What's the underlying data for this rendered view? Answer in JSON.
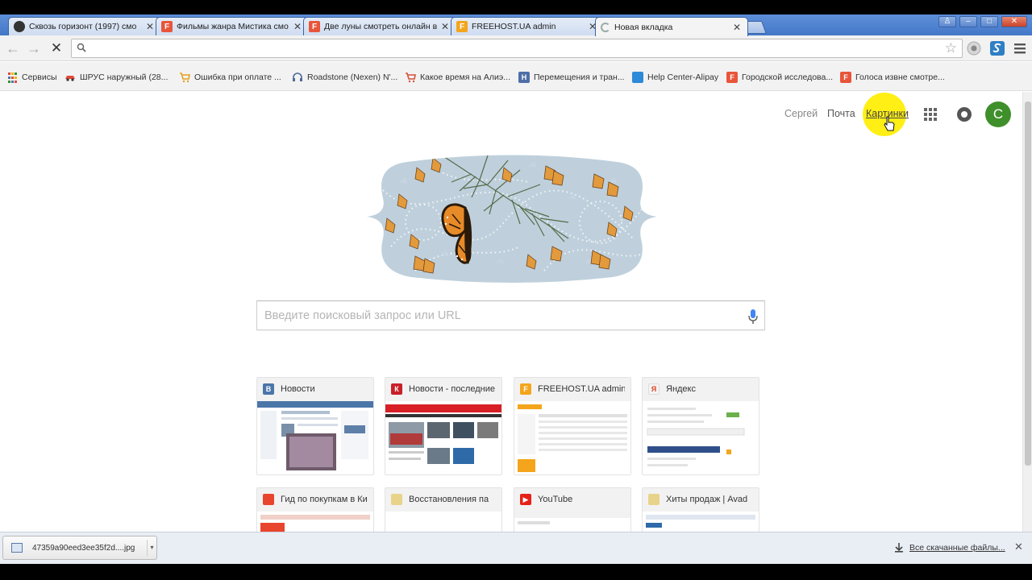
{
  "tabs": [
    {
      "title": "Сквозь горизонт (1997) смо",
      "icon": "mask-favicon-icon",
      "color": "#333333"
    },
    {
      "title": "Фильмы жанра Мистика смо",
      "icon": "f-favicon-icon",
      "color": "#e8553b"
    },
    {
      "title": "Две луны смотреть онлайн в",
      "icon": "f-favicon-icon",
      "color": "#e8553b"
    },
    {
      "title": "FREEHOST.UA admin",
      "icon": "freehost-favicon-icon",
      "color": "#f4a51c"
    },
    {
      "title": "Новая вкладка",
      "icon": "loading-spinner-icon",
      "color": "#999999",
      "active": true
    }
  ],
  "toolbar": {
    "search_glyph": "🔍"
  },
  "bookmarks": [
    {
      "label": "Сервисы",
      "color": "#d8473a",
      "glyph": ""
    },
    {
      "label": "ШРУС наружный (28...",
      "color": "#e04a3a",
      "glyph": ""
    },
    {
      "label": "Ошибка при оплате ...",
      "color": "#e6a021",
      "glyph": ""
    },
    {
      "label": "Roadstone (Nexen) N'...",
      "color": "#4d6a9a",
      "glyph": ""
    },
    {
      "label": "Какое время на Алиэ...",
      "color": "#d5523b",
      "glyph": ""
    },
    {
      "label": "Перемещения и тран...",
      "color": "#4e6ea6",
      "glyph": "H"
    },
    {
      "label": "Help Center-Alipay",
      "color": "#2c8ad8",
      "glyph": ""
    },
    {
      "label": "Городской исследова...",
      "color": "#e8553b",
      "glyph": "F"
    },
    {
      "label": "Голоса извне смотре...",
      "color": "#e8553b",
      "glyph": "F"
    }
  ],
  "header": {
    "user": "Сергей",
    "mail": "Почта",
    "images": "Картинки",
    "avatar_letter": "С"
  },
  "search": {
    "placeholder": "Введите поисковый запрос или URL"
  },
  "tiles": [
    {
      "title": "Новости",
      "color": "#4a76a8",
      "glyph": "В"
    },
    {
      "title": "Новости - последние",
      "color": "#c8202a",
      "glyph": "К"
    },
    {
      "title": "FREEHOST.UA admin",
      "color": "#f4a51c",
      "glyph": "F"
    },
    {
      "title": "Яндекс",
      "color": "#e8e8e8",
      "glyph": "Я"
    },
    {
      "title": "Гид по покупкам в Ки",
      "color": "#e8452e",
      "glyph": ""
    },
    {
      "title": "Восстановления па",
      "color": "#e0c060",
      "glyph": ""
    },
    {
      "title": "YouTube",
      "color": "#e62117",
      "glyph": "▶"
    },
    {
      "title": "Хиты продаж | Avad",
      "color": "#d0d0d0",
      "glyph": ""
    }
  ],
  "download": {
    "filename": "47359a90eed3ee35f2d....jpg",
    "all_label": "Все скачанные файлы..."
  }
}
